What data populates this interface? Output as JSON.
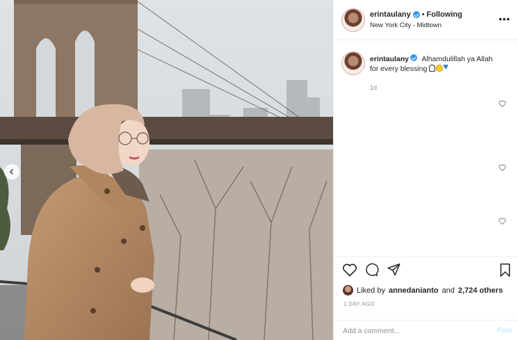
{
  "post": {
    "username": "erintaulany",
    "following_label": "Following",
    "separator": "•",
    "location": "New York City - Midtown",
    "more_icon": "more-horizontal-icon"
  },
  "caption": {
    "username": "erintaulany",
    "text": "Alhamdulillah ya Allah for every blessing",
    "emojis": [
      "folded-hands",
      "smiling-face",
      "blue-heart"
    ],
    "time": "1d"
  },
  "actions": {
    "icons": [
      "heart-icon",
      "comment-icon",
      "share-icon",
      "bookmark-icon"
    ],
    "liked_by_prefix": "Liked by",
    "liked_by_user": "annedanianto",
    "liked_by_and": "and",
    "liked_by_count": "2,724 others",
    "post_time": "1 DAY AGO"
  },
  "comment_box": {
    "placeholder": "Add a comment...",
    "post_label": "Post"
  },
  "colors": {
    "verified": "#3897f0",
    "muted_text": "#8e8e8e",
    "post_button_disabled": "#b2dffc",
    "avatar_ring": "#e1a4a4"
  }
}
